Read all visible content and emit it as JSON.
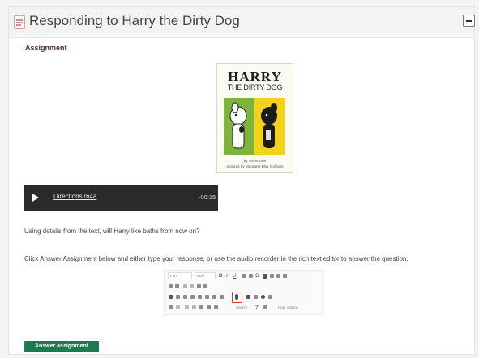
{
  "header": {
    "title": "Responding to Harry the Dirty Dog",
    "collapse_icon": "minus-icon"
  },
  "assignment": {
    "label": "Assignment",
    "book_cover": {
      "title": "HARRY",
      "subtitle": "THE DIRTY DOG",
      "credit_line_1": "by Gene Zion",
      "credit_line_2": "pictures by Margaret Bloy Graham"
    },
    "audio_player": {
      "file_link": "Directions.m4a",
      "time": "-00:15",
      "play_icon": "play-icon"
    },
    "question": "Using details from the text, will Harry like baths from now on?",
    "instructions": "Click Answer Assignment below and either type your response, or use the audio recorder in the rich text editor to answer the question."
  },
  "editor_toolbar": {
    "font_select": "Font",
    "size_select": "Size",
    "bold": "B",
    "italic": "I",
    "underline": "U",
    "omega": "Ω",
    "source": "Source",
    "help": "?",
    "hide_options": "Hide options",
    "highlighted_icon": "microphone-icon"
  },
  "actions": {
    "answer_button": "Answer assignment"
  },
  "colors": {
    "accent_label": "#5a2a47",
    "button_green": "#1a7a52",
    "audio_bg": "#2a2a2a",
    "highlight_red": "#e0392f"
  }
}
